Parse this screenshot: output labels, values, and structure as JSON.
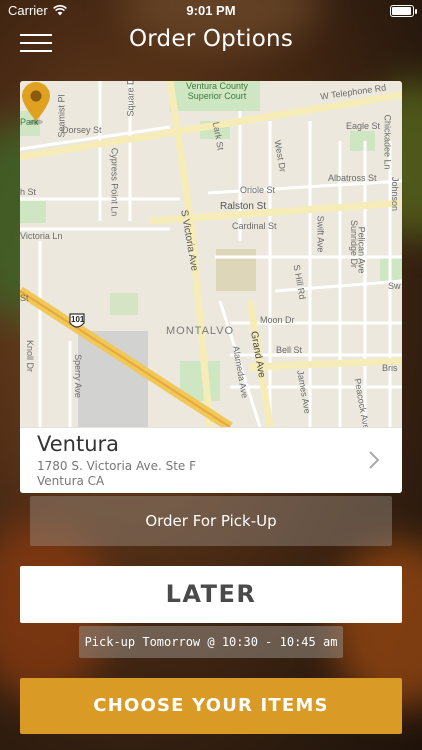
{
  "status_bar": {
    "carrier": "Carrier",
    "time": "9:01 PM",
    "battery_level": 0.95
  },
  "nav": {
    "title": "Order Options",
    "menu_icon": "hamburger-menu-icon"
  },
  "map": {
    "labels": {
      "court": "Ventura County\nSuperior Court",
      "telephone": "W Telephone Rd",
      "park": "Park",
      "seamist": "Seamist Pl",
      "square": "Square Dr",
      "dorsey": "Dorsey St",
      "eagle": "Eagle St",
      "chickadee": "Chickadee Ln",
      "lark": "Lark St",
      "west": "West Dr",
      "cypress": "Cypress Point Ln",
      "albatross": "Albatross St",
      "johnson": "Johnson",
      "oriole": "Oriole St",
      "hst": "h St",
      "ralston": "Ralston St",
      "victoria": "S Victoria Ave",
      "cardinal": "Cardinal St",
      "swift": "Swift Ave",
      "sunridge": "Sunridge Dr",
      "pelican": "Pelican Ave",
      "victoriaLn": "Victoria Ln",
      "shill": "S Hill Rd",
      "hwy101": "101",
      "montalvo": "MONTALVO",
      "moon": "Moon Dr",
      "grand": "Grand Ave",
      "bell": "Bell St",
      "knoll": "Knoll Dr",
      "sperry": "Sperry Ave",
      "alameda": "Alameda Ave",
      "james": "James Ave",
      "peacock": "Peacock Ave",
      "bris": "Bris",
      "sw": "Sw",
      "st": "St"
    }
  },
  "location": {
    "name": "Ventura",
    "address_line1": "1780 S. Victoria Ave. Ste F",
    "address_line2": "Ventura CA",
    "chevron_icon": "chevron-right-icon"
  },
  "order_type": {
    "label": "Order For Pick-Up"
  },
  "timing": {
    "label": "LATER",
    "pickup_time": "Pick-up Tomorrow @ 10:30 - 10:45 am"
  },
  "primary_action": {
    "label": "CHOOSE YOUR ITEMS"
  },
  "colors": {
    "accent": "#d99a26",
    "pin": "#e0a020"
  }
}
